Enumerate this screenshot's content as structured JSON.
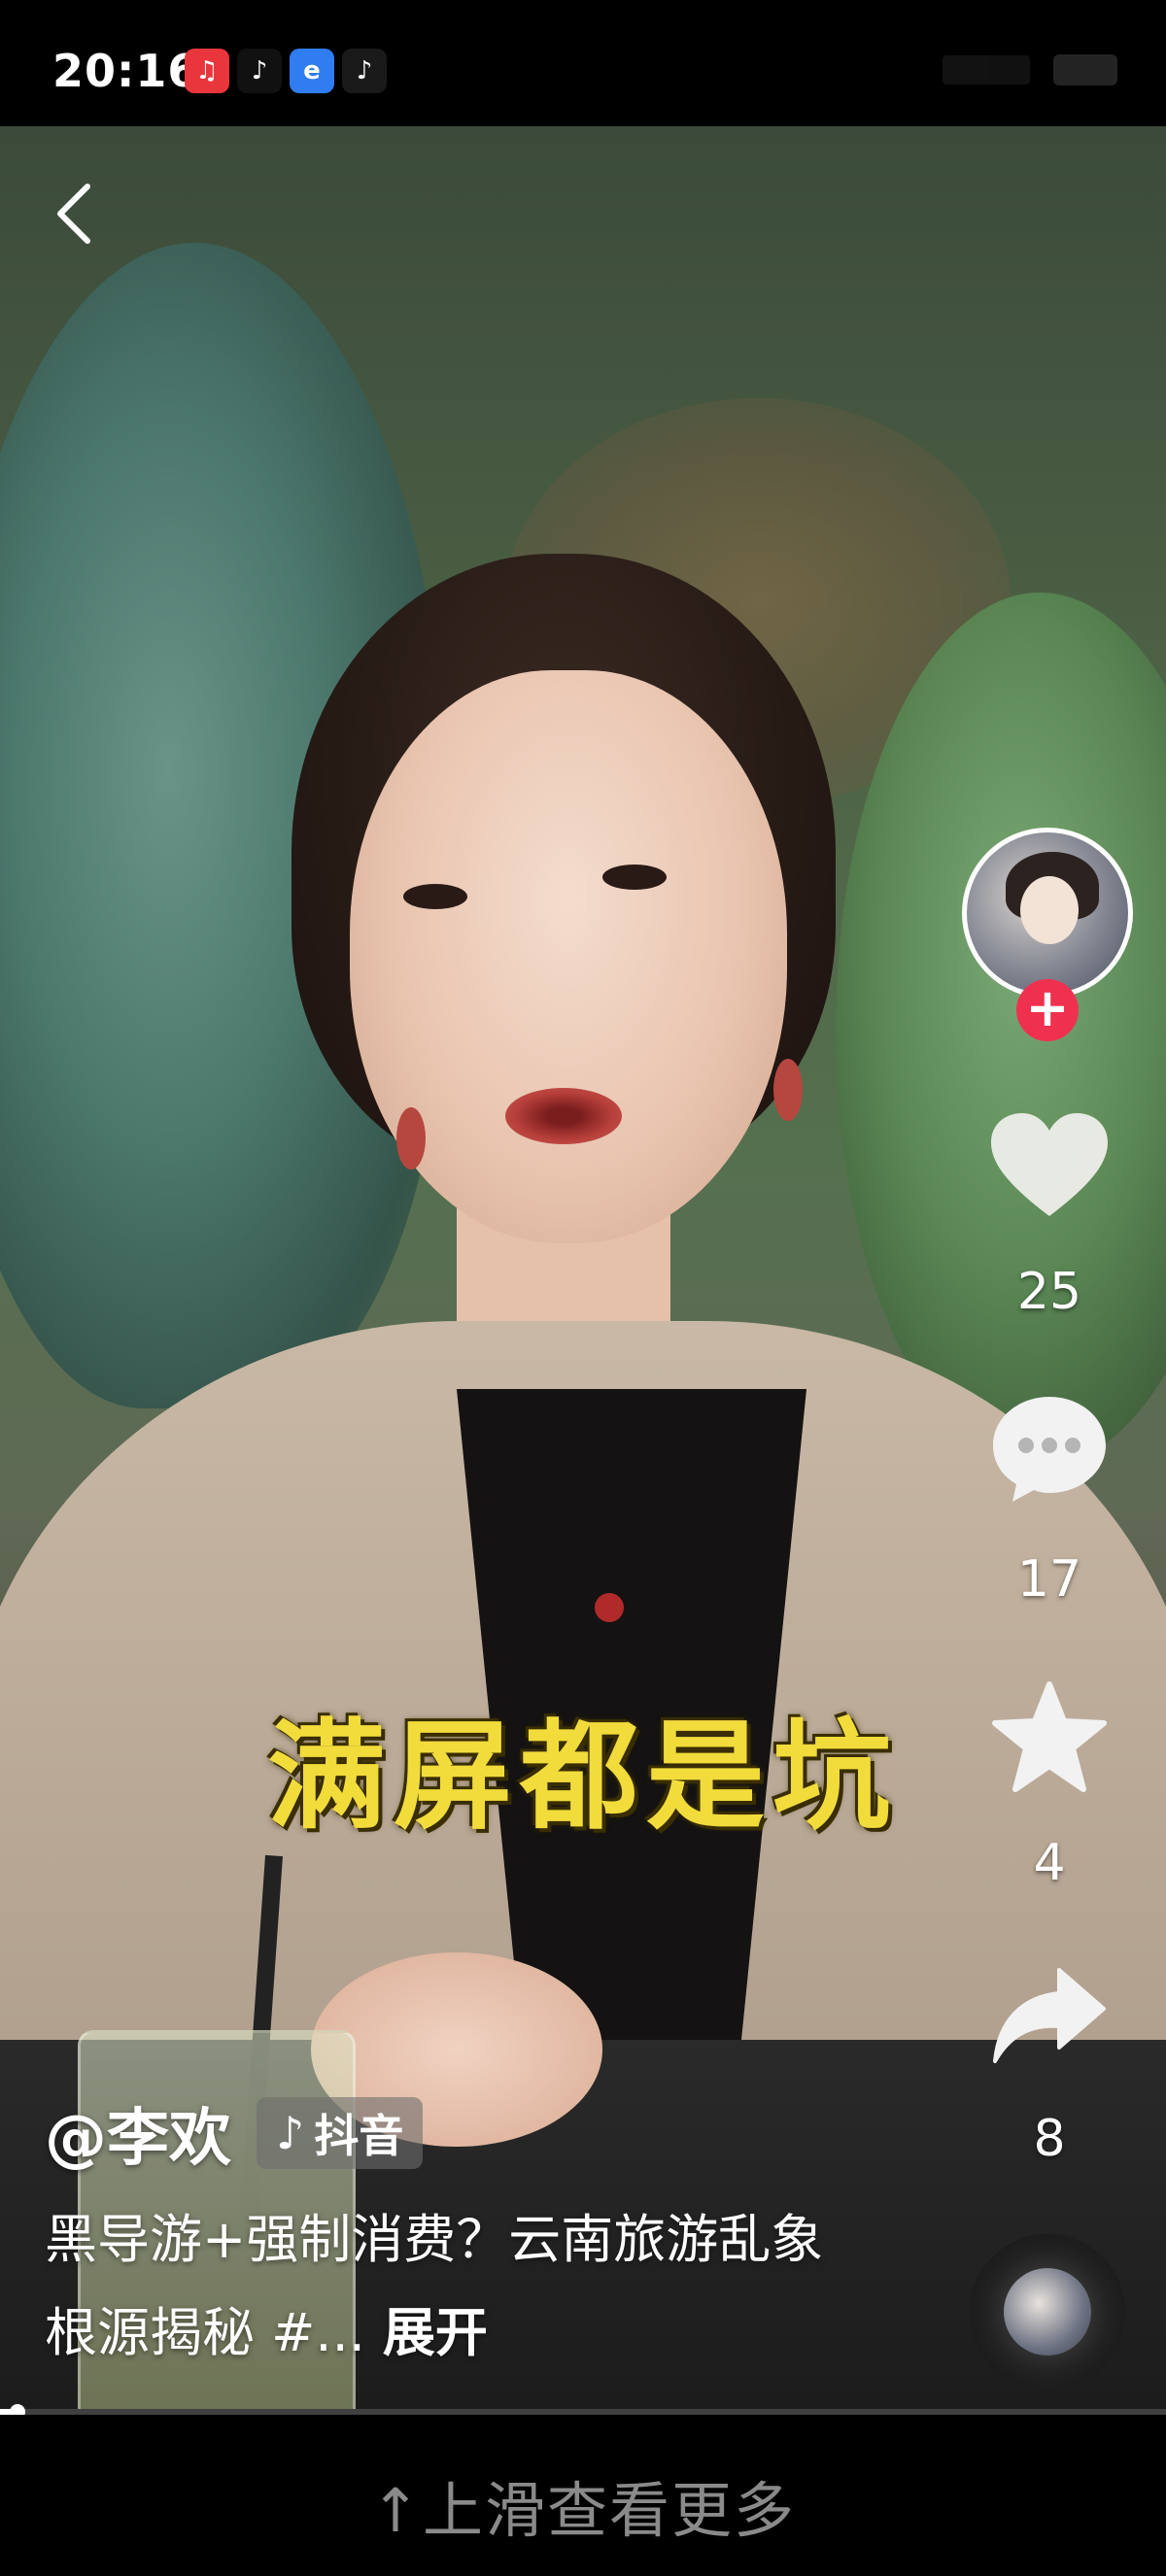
{
  "status_bar": {
    "time": "20:16",
    "apps": [
      {
        "icon": "app-red-icon",
        "glyph": "♫",
        "color": "#e8363c"
      },
      {
        "icon": "douyin-icon",
        "glyph": "♪",
        "color": "#111111"
      },
      {
        "icon": "browser-icon",
        "glyph": "e",
        "color": "#2f7df0"
      },
      {
        "icon": "douyin-lite-icon",
        "glyph": "♪",
        "color": "#1a1a1a"
      }
    ]
  },
  "video": {
    "subtitle": "满屏都是坑",
    "progress_fraction": 0.015
  },
  "rail": {
    "likes": "25",
    "comments": "17",
    "favorites": "4",
    "shares": "8",
    "follow_glyph": "+"
  },
  "author": {
    "name": "@李欢",
    "source_label": "抖音"
  },
  "caption": {
    "text": "黑导游+强制消费？云南旅游乱象根源揭秘 #...",
    "expand_label": "展开"
  },
  "bottom_hint": "↑上滑查看更多",
  "colors": {
    "subtitle": "#f2dc3c",
    "follow": "#f0304f",
    "background": "#000000"
  }
}
